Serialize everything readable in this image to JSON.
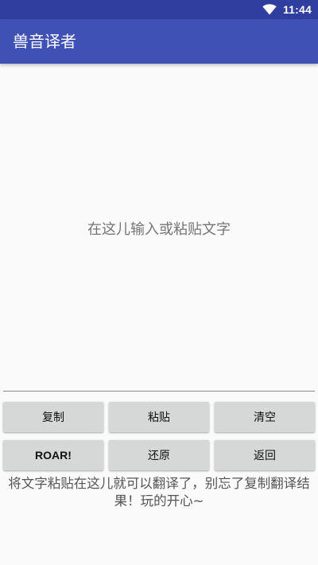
{
  "status_bar": {
    "time": "11:44",
    "icons": [
      "wifi-icon"
    ],
    "background": "#303f9f"
  },
  "app_bar": {
    "title": "兽音译者",
    "background": "#3f51b5"
  },
  "input": {
    "placeholder": "在这儿输入或粘贴文字",
    "value": ""
  },
  "buttons": {
    "row1": [
      "复制",
      "粘贴",
      "清空"
    ],
    "row2": [
      "ROAR!",
      "还原",
      "返回"
    ]
  },
  "hint": "将文字粘贴在这儿就可以翻译了，别忘了复制翻译结果！玩的开心~"
}
